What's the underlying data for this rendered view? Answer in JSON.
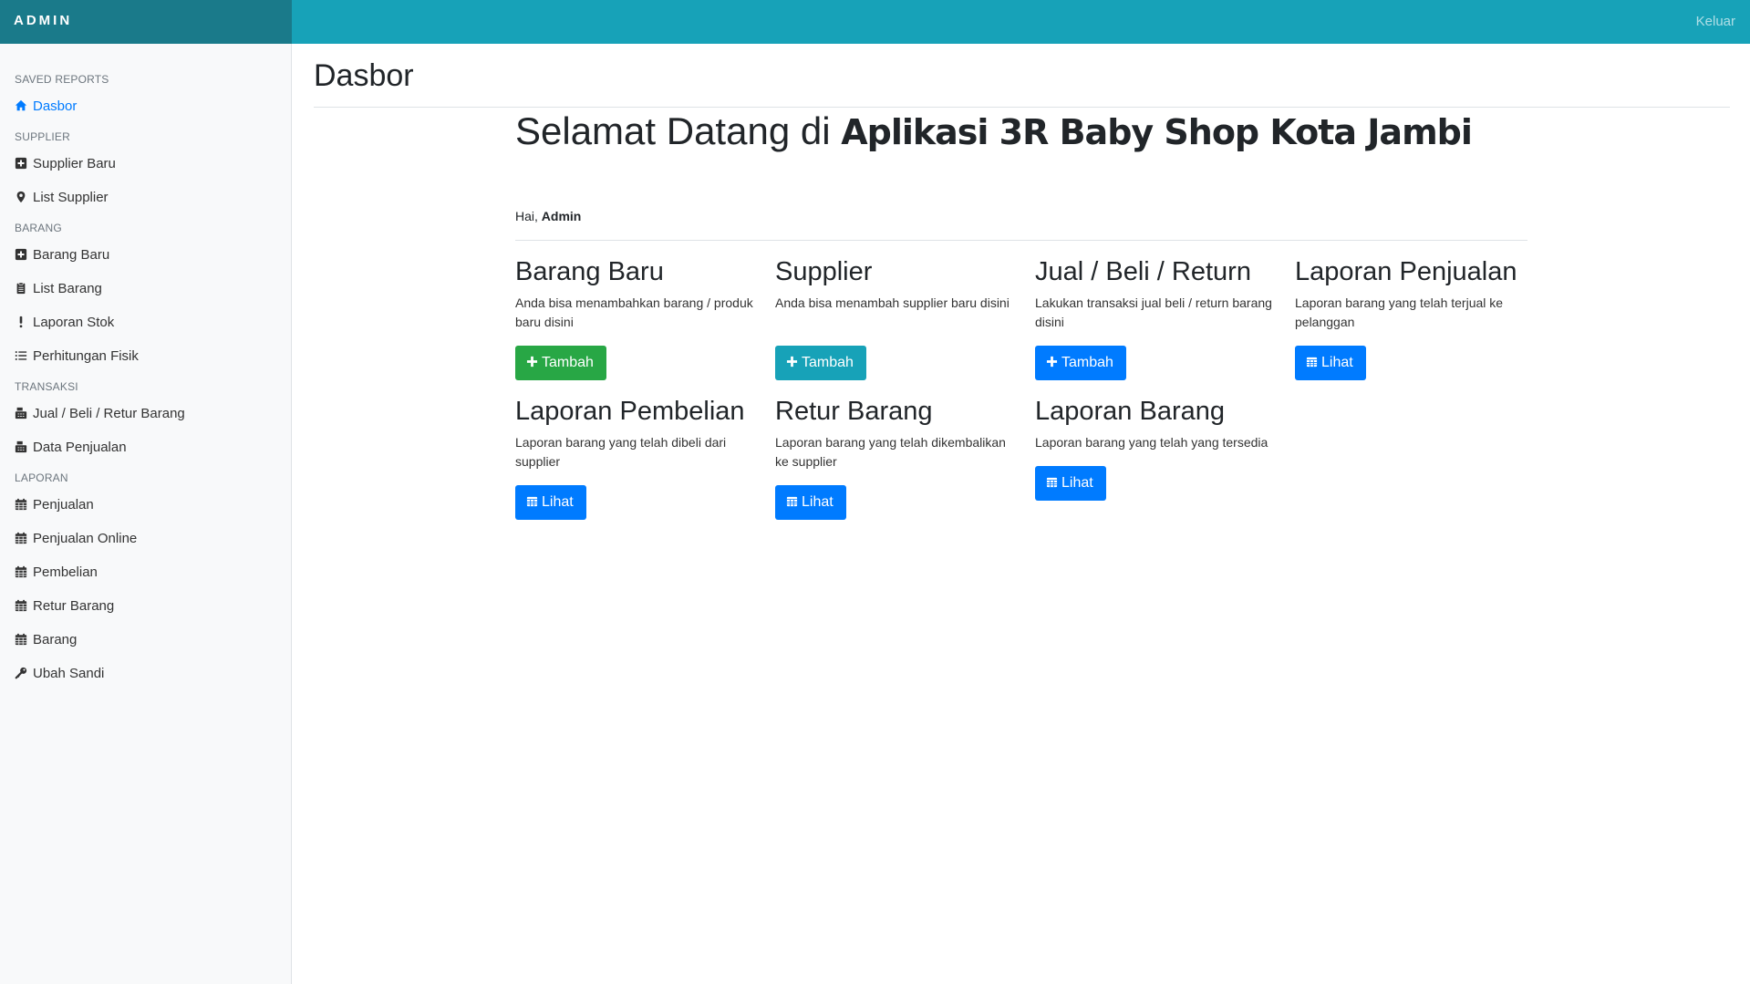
{
  "app": {
    "brand": "ADMIN",
    "signout": "Keluar"
  },
  "sidebar": {
    "sections": [
      {
        "heading": "SAVED REPORTS",
        "items": [
          {
            "label": "Dasbor",
            "icon": "home-icon",
            "active": true
          }
        ]
      },
      {
        "heading": "SUPPLIER",
        "items": [
          {
            "label": "Supplier Baru",
            "icon": "plus-square-icon"
          },
          {
            "label": "List Supplier",
            "icon": "map-marker-icon"
          }
        ]
      },
      {
        "heading": "BARANG",
        "items": [
          {
            "label": "Barang Baru",
            "icon": "plus-square-icon"
          },
          {
            "label": "List Barang",
            "icon": "clipboard-icon"
          },
          {
            "label": "Laporan Stok",
            "icon": "exclamation-icon"
          },
          {
            "label": "Perhitungan Fisik",
            "icon": "list-icon"
          }
        ]
      },
      {
        "heading": "TRANSAKSI",
        "items": [
          {
            "label": "Jual / Beli / Retur Barang",
            "icon": "register-icon"
          },
          {
            "label": "Data Penjualan",
            "icon": "register-icon"
          }
        ]
      },
      {
        "heading": "LAPORAN",
        "items": [
          {
            "label": "Penjualan",
            "icon": "calendar-icon"
          },
          {
            "label": "Penjualan Online",
            "icon": "calendar-icon"
          },
          {
            "label": "Pembelian",
            "icon": "calendar-icon"
          },
          {
            "label": "Retur Barang",
            "icon": "calendar-icon"
          },
          {
            "label": "Barang",
            "icon": "calendar-icon"
          },
          {
            "label": "Ubah Sandi",
            "icon": "key-icon"
          }
        ]
      }
    ]
  },
  "main": {
    "title": "Dasbor",
    "welcome_prefix": "Selamat Datang di",
    "app_name": "Aplikasi 3R Baby Shop Kota Jambi",
    "greeting_prefix": "Hai,",
    "greeting_user": "Admin",
    "cards": [
      {
        "title": "Barang Baru",
        "desc": "Anda bisa menambahkan barang / produk baru disini",
        "button": "Tambah",
        "button_icon": "plus-icon"
      },
      {
        "title": "Supplier",
        "desc": "Anda bisa menambah supplier baru disini",
        "button": "Tambah",
        "button_icon": "plus-icon"
      },
      {
        "title": "Jual / Beli / Return",
        "desc": "Lakukan transaksi jual beli / return barang disini",
        "button": "Tambah",
        "button_icon": "plus-icon"
      },
      {
        "title": "Laporan Penjualan",
        "desc": "Laporan barang yang telah terjual ke pelanggan",
        "button": "Lihat",
        "button_icon": "calendar-icon"
      },
      {
        "title": "Laporan Pembelian",
        "desc": "Laporan barang yang telah dibeli dari supplier",
        "button": "Lihat",
        "button_icon": "calendar-icon"
      },
      {
        "title": "Retur Barang",
        "desc": "Laporan barang yang telah dikembalikan ke supplier",
        "button": "Lihat",
        "button_icon": "calendar-icon"
      },
      {
        "title": "Laporan Barang",
        "desc": "Laporan barang yang telah yang tersedia",
        "button": "Lihat",
        "button_icon": "calendar-icon"
      }
    ]
  },
  "colors": {
    "topbar": "#17a2b8",
    "brand_bg": "#1a7a8a",
    "success": "#28a745",
    "info": "#17a2b8",
    "primary": "#007bff",
    "active_link": "#007bff"
  }
}
